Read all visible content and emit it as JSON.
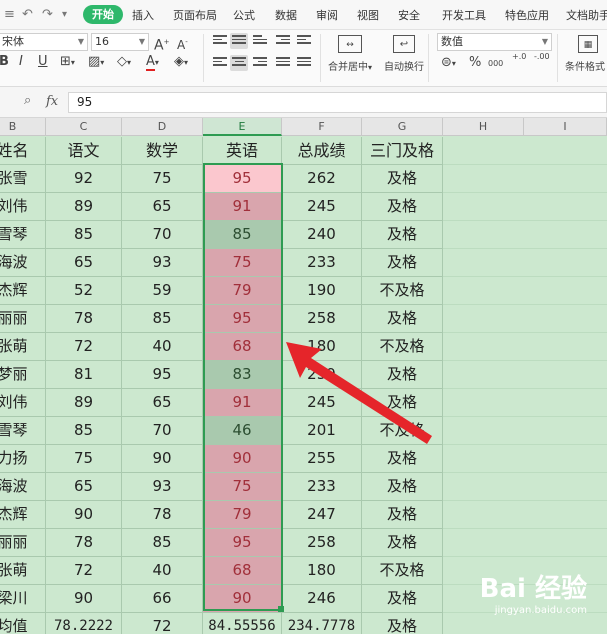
{
  "app": {
    "tabs": [
      "开始",
      "插入",
      "页面布局",
      "公式",
      "数据",
      "审阅",
      "视图",
      "安全",
      "开发工具",
      "特色应用",
      "文档助手"
    ],
    "active_tab": "开始"
  },
  "toolbar": {
    "font_name": "宋体",
    "font_size": "16",
    "number_format": "数值",
    "merge_label": "合并居中",
    "wrap_label": "自动换行",
    "cond_format_label": "条件格式",
    "bold": "B",
    "italic": "I",
    "underline": "U",
    "grow_font": "A",
    "shrink_font": "A",
    "percent": "%",
    "comma": "000",
    "inc_decimal": "+.0",
    "dec_decimal": "-.00",
    "font_color_accent": "#e02020"
  },
  "formula_bar": {
    "fx": "fx",
    "value": "95"
  },
  "sheet": {
    "columns": [
      "B",
      "C",
      "D",
      "E",
      "F",
      "G",
      "H",
      "I"
    ],
    "selected_column": "E",
    "headers": [
      "姓名",
      "语文",
      "数学",
      "英语",
      "总成绩",
      "三门及格"
    ],
    "rows": [
      {
        "name": "张雪",
        "yuwen": "92",
        "shuxue": "75",
        "yingyu": "95",
        "total": "262",
        "pass": "及格",
        "hl": "pink"
      },
      {
        "name": "刘伟",
        "yuwen": "89",
        "shuxue": "65",
        "yingyu": "91",
        "total": "245",
        "pass": "及格",
        "hl": "red"
      },
      {
        "name": "雪琴",
        "yuwen": "85",
        "shuxue": "70",
        "yingyu": "85",
        "total": "240",
        "pass": "及格",
        "hl": "green"
      },
      {
        "name": "海波",
        "yuwen": "65",
        "shuxue": "93",
        "yingyu": "75",
        "total": "233",
        "pass": "及格",
        "hl": "red"
      },
      {
        "name": "杰辉",
        "yuwen": "52",
        "shuxue": "59",
        "yingyu": "79",
        "total": "190",
        "pass": "不及格",
        "hl": "red"
      },
      {
        "name": "丽丽",
        "yuwen": "78",
        "shuxue": "85",
        "yingyu": "95",
        "total": "258",
        "pass": "及格",
        "hl": "red"
      },
      {
        "name": "张萌",
        "yuwen": "72",
        "shuxue": "40",
        "yingyu": "68",
        "total": "180",
        "pass": "不及格",
        "hl": "red"
      },
      {
        "name": "梦丽",
        "yuwen": "81",
        "shuxue": "95",
        "yingyu": "83",
        "total": "259",
        "pass": "及格",
        "hl": "green"
      },
      {
        "name": "刘伟",
        "yuwen": "89",
        "shuxue": "65",
        "yingyu": "91",
        "total": "245",
        "pass": "及格",
        "hl": "red"
      },
      {
        "name": "雪琴",
        "yuwen": "85",
        "shuxue": "70",
        "yingyu": "46",
        "total": "201",
        "pass": "不及格",
        "hl": "green"
      },
      {
        "name": "力扬",
        "yuwen": "75",
        "shuxue": "90",
        "yingyu": "90",
        "total": "255",
        "pass": "及格",
        "hl": "red"
      },
      {
        "name": "海波",
        "yuwen": "65",
        "shuxue": "93",
        "yingyu": "75",
        "total": "233",
        "pass": "及格",
        "hl": "red"
      },
      {
        "name": "杰辉",
        "yuwen": "90",
        "shuxue": "78",
        "yingyu": "79",
        "total": "247",
        "pass": "及格",
        "hl": "red"
      },
      {
        "name": "丽丽",
        "yuwen": "78",
        "shuxue": "85",
        "yingyu": "95",
        "total": "258",
        "pass": "及格",
        "hl": "red"
      },
      {
        "name": "张萌",
        "yuwen": "72",
        "shuxue": "40",
        "yingyu": "68",
        "total": "180",
        "pass": "不及格",
        "hl": "red"
      },
      {
        "name": "梁川",
        "yuwen": "90",
        "shuxue": "66",
        "yingyu": "90",
        "total": "246",
        "pass": "及格",
        "hl": "red"
      },
      {
        "name": "均值",
        "yuwen": "78.2222",
        "shuxue": "72",
        "yingyu": "84.55556",
        "total": "234.7778",
        "pass": "及格",
        "hl": "none"
      }
    ]
  },
  "watermark": {
    "brand": "Bai 经验",
    "url": "jingyan.baidu.com"
  },
  "colors": {
    "sheet_bg": "#cce8cf",
    "selection": "#2e9b52",
    "red_fill": "#d9a5ad",
    "pink_fill": "#fbc7ce",
    "green_fill": "#a9c9ae",
    "red_text": "#a12f3a",
    "arrow": "#e5252a",
    "tab_active": "#2eb86b"
  },
  "icons": [
    "undo-icon",
    "redo-icon",
    "zoom-icon",
    "merge-center-icon",
    "wrap-text-icon",
    "eraser-icon",
    "border-icon",
    "fill-color-icon",
    "font-color-icon",
    "align-icon"
  ]
}
